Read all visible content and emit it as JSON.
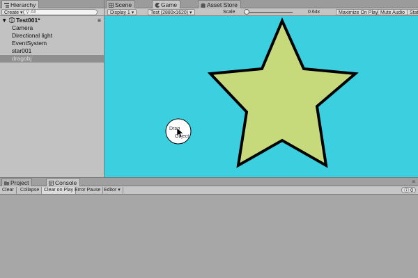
{
  "hierarchy": {
    "tab_label": "Hierarchy",
    "create_label": "Create",
    "search_placeholder": "All",
    "scene_name": "Test001*",
    "items": [
      {
        "label": "Camera"
      },
      {
        "label": "Directional light"
      },
      {
        "label": "EventSystem"
      },
      {
        "label": "star001"
      },
      {
        "label": "dragobj"
      }
    ],
    "selected_item": "dragobj"
  },
  "game_view": {
    "tabs": [
      {
        "label": "Scene"
      },
      {
        "label": "Game"
      },
      {
        "label": "Asset Store"
      }
    ],
    "display_label": "Display 1",
    "resolution_label": "Test (2880x1620)",
    "scale_label": "Scale",
    "scale_value": "0.64x",
    "scale_fraction": 0.0,
    "maximize_label": "Maximize On Play",
    "mute_label": "Mute Audio",
    "stats_label": "Stats",
    "background_color": "#3ccfe0",
    "star_color": "#c6da7b",
    "drag_label_line1": "Drag",
    "drag_label_line2": "Object"
  },
  "bottom_panel": {
    "tabs": [
      {
        "label": "Project"
      },
      {
        "label": "Console"
      }
    ],
    "buttons": {
      "clear": "Clear",
      "collapse": "Collapse",
      "clear_on_play": "Clear on Play",
      "error_pause": "Error Pause",
      "editor": "Editor"
    },
    "message_count": "0"
  }
}
